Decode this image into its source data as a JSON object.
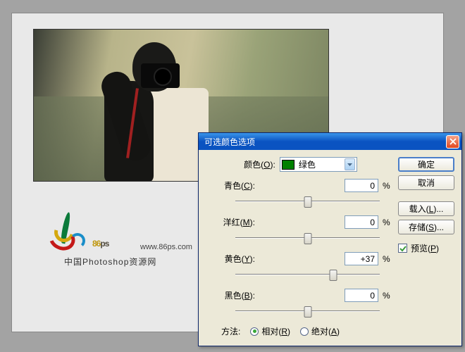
{
  "dialog": {
    "title": "可选颜色选项",
    "color_label": "颜色(O):",
    "color_value": "绿色",
    "color_swatch": "#008000",
    "sliders": [
      {
        "label": "青色(C):",
        "value": "0",
        "pos": 50
      },
      {
        "label": "洋红(M):",
        "value": "0",
        "pos": 50
      },
      {
        "label": "黄色(Y):",
        "value": "+37",
        "pos": 68
      },
      {
        "label": "黑色(B):",
        "value": "0",
        "pos": 50
      }
    ],
    "method_label": "方法:",
    "method_relative": "相对(R)",
    "method_absolute": "绝对(A)",
    "method_selected": "relative",
    "buttons": {
      "ok": "确定",
      "cancel": "取消",
      "load": "载入(L)...",
      "save": "存储(S)..."
    },
    "preview_label": "预览(P)",
    "preview_checked": true,
    "percent": "%"
  },
  "logo": {
    "brand_num": "86",
    "brand_suffix": "ps",
    "url": "www.86ps.com",
    "subtitle": "中国Photoshop资源网"
  }
}
